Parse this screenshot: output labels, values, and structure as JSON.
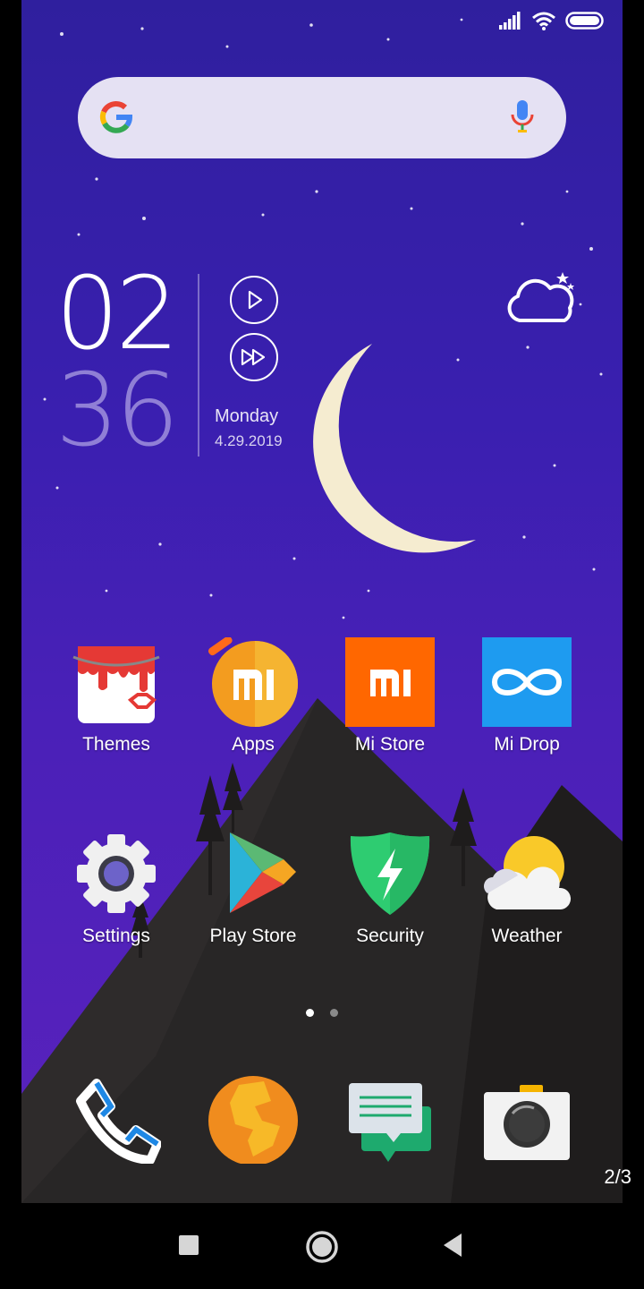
{
  "status_bar": {
    "icons": [
      "signal-icon",
      "wifi-icon",
      "battery-icon"
    ]
  },
  "search": {
    "icons": [
      "google-logo-icon",
      "microphone-icon"
    ]
  },
  "clock": {
    "hour": "02",
    "minute": "36",
    "day": "Monday",
    "date": "4.29.2019"
  },
  "media": {
    "icons": [
      "play-icon",
      "fast-forward-icon"
    ]
  },
  "weather_widget": {
    "icon": "night-cloud-icon"
  },
  "apps_row1": [
    {
      "label": "Themes"
    },
    {
      "label": "Apps"
    },
    {
      "label": "Mi Store"
    },
    {
      "label": "Mi Drop"
    }
  ],
  "apps_row2": [
    {
      "label": "Settings"
    },
    {
      "label": "Play Store"
    },
    {
      "label": "Security"
    },
    {
      "label": "Weather"
    }
  ],
  "dock": {
    "icons": [
      "phone-icon",
      "browser-icon",
      "messages-icon",
      "camera-icon"
    ]
  },
  "page_dots": {
    "count": 2,
    "active": 1
  },
  "page_indicator": "2/3",
  "nav": {
    "icons": [
      "recents-icon",
      "home-icon",
      "back-icon"
    ]
  },
  "colors": {
    "bg_top": "#2f1f9e",
    "bg_bottom": "#5a22bd",
    "mountain": "#282626",
    "moon": "#f5ecd0"
  }
}
